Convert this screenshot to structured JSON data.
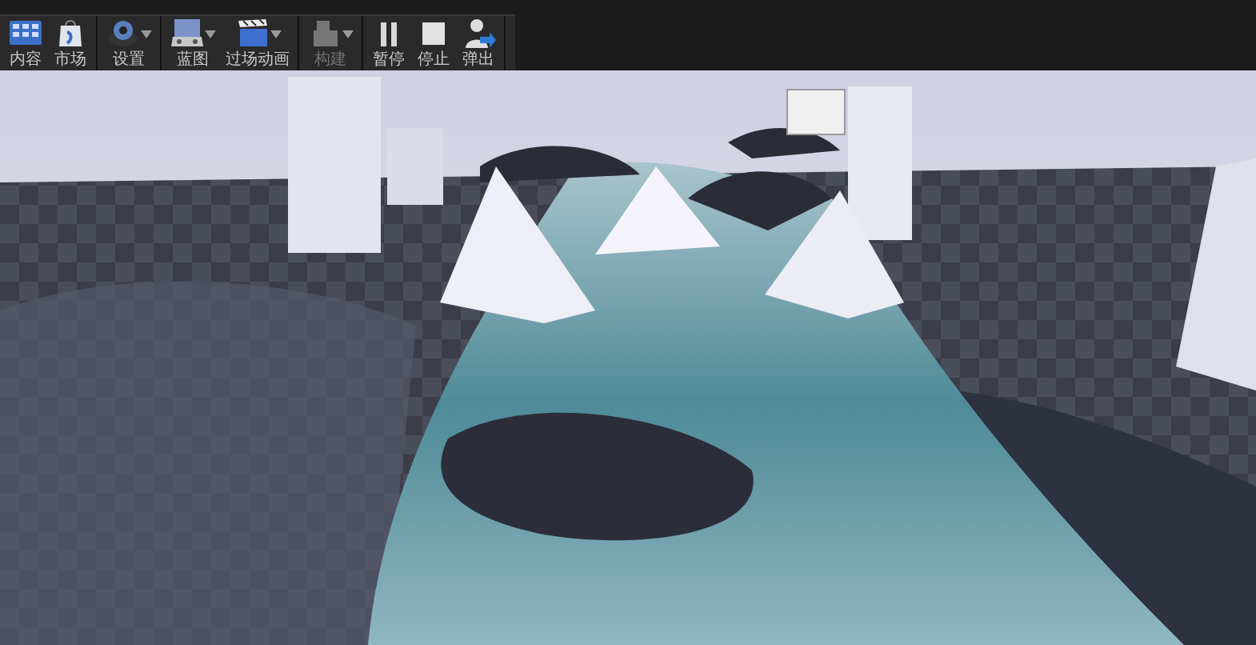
{
  "toolbar": {
    "groups": [
      {
        "buttons": [
          {
            "kind": "content",
            "label": "内容",
            "dropdown": false,
            "disabled": false
          },
          {
            "kind": "market",
            "label": "市场",
            "dropdown": false,
            "disabled": false
          }
        ]
      },
      {
        "buttons": [
          {
            "kind": "settings",
            "label": "设置",
            "dropdown": true,
            "disabled": false
          }
        ]
      },
      {
        "buttons": [
          {
            "kind": "blueprint",
            "label": "蓝图",
            "dropdown": true,
            "disabled": false
          },
          {
            "kind": "cinematics",
            "label": "过场动画",
            "dropdown": true,
            "disabled": false
          }
        ]
      },
      {
        "buttons": [
          {
            "kind": "build",
            "label": "构建",
            "dropdown": true,
            "disabled": true
          }
        ]
      },
      {
        "buttons": [
          {
            "kind": "pause",
            "label": "暂停",
            "dropdown": false,
            "disabled": false
          },
          {
            "kind": "stop",
            "label": "停止",
            "dropdown": false,
            "disabled": false
          },
          {
            "kind": "eject",
            "label": "弹出",
            "dropdown": false,
            "disabled": false
          }
        ]
      }
    ]
  }
}
